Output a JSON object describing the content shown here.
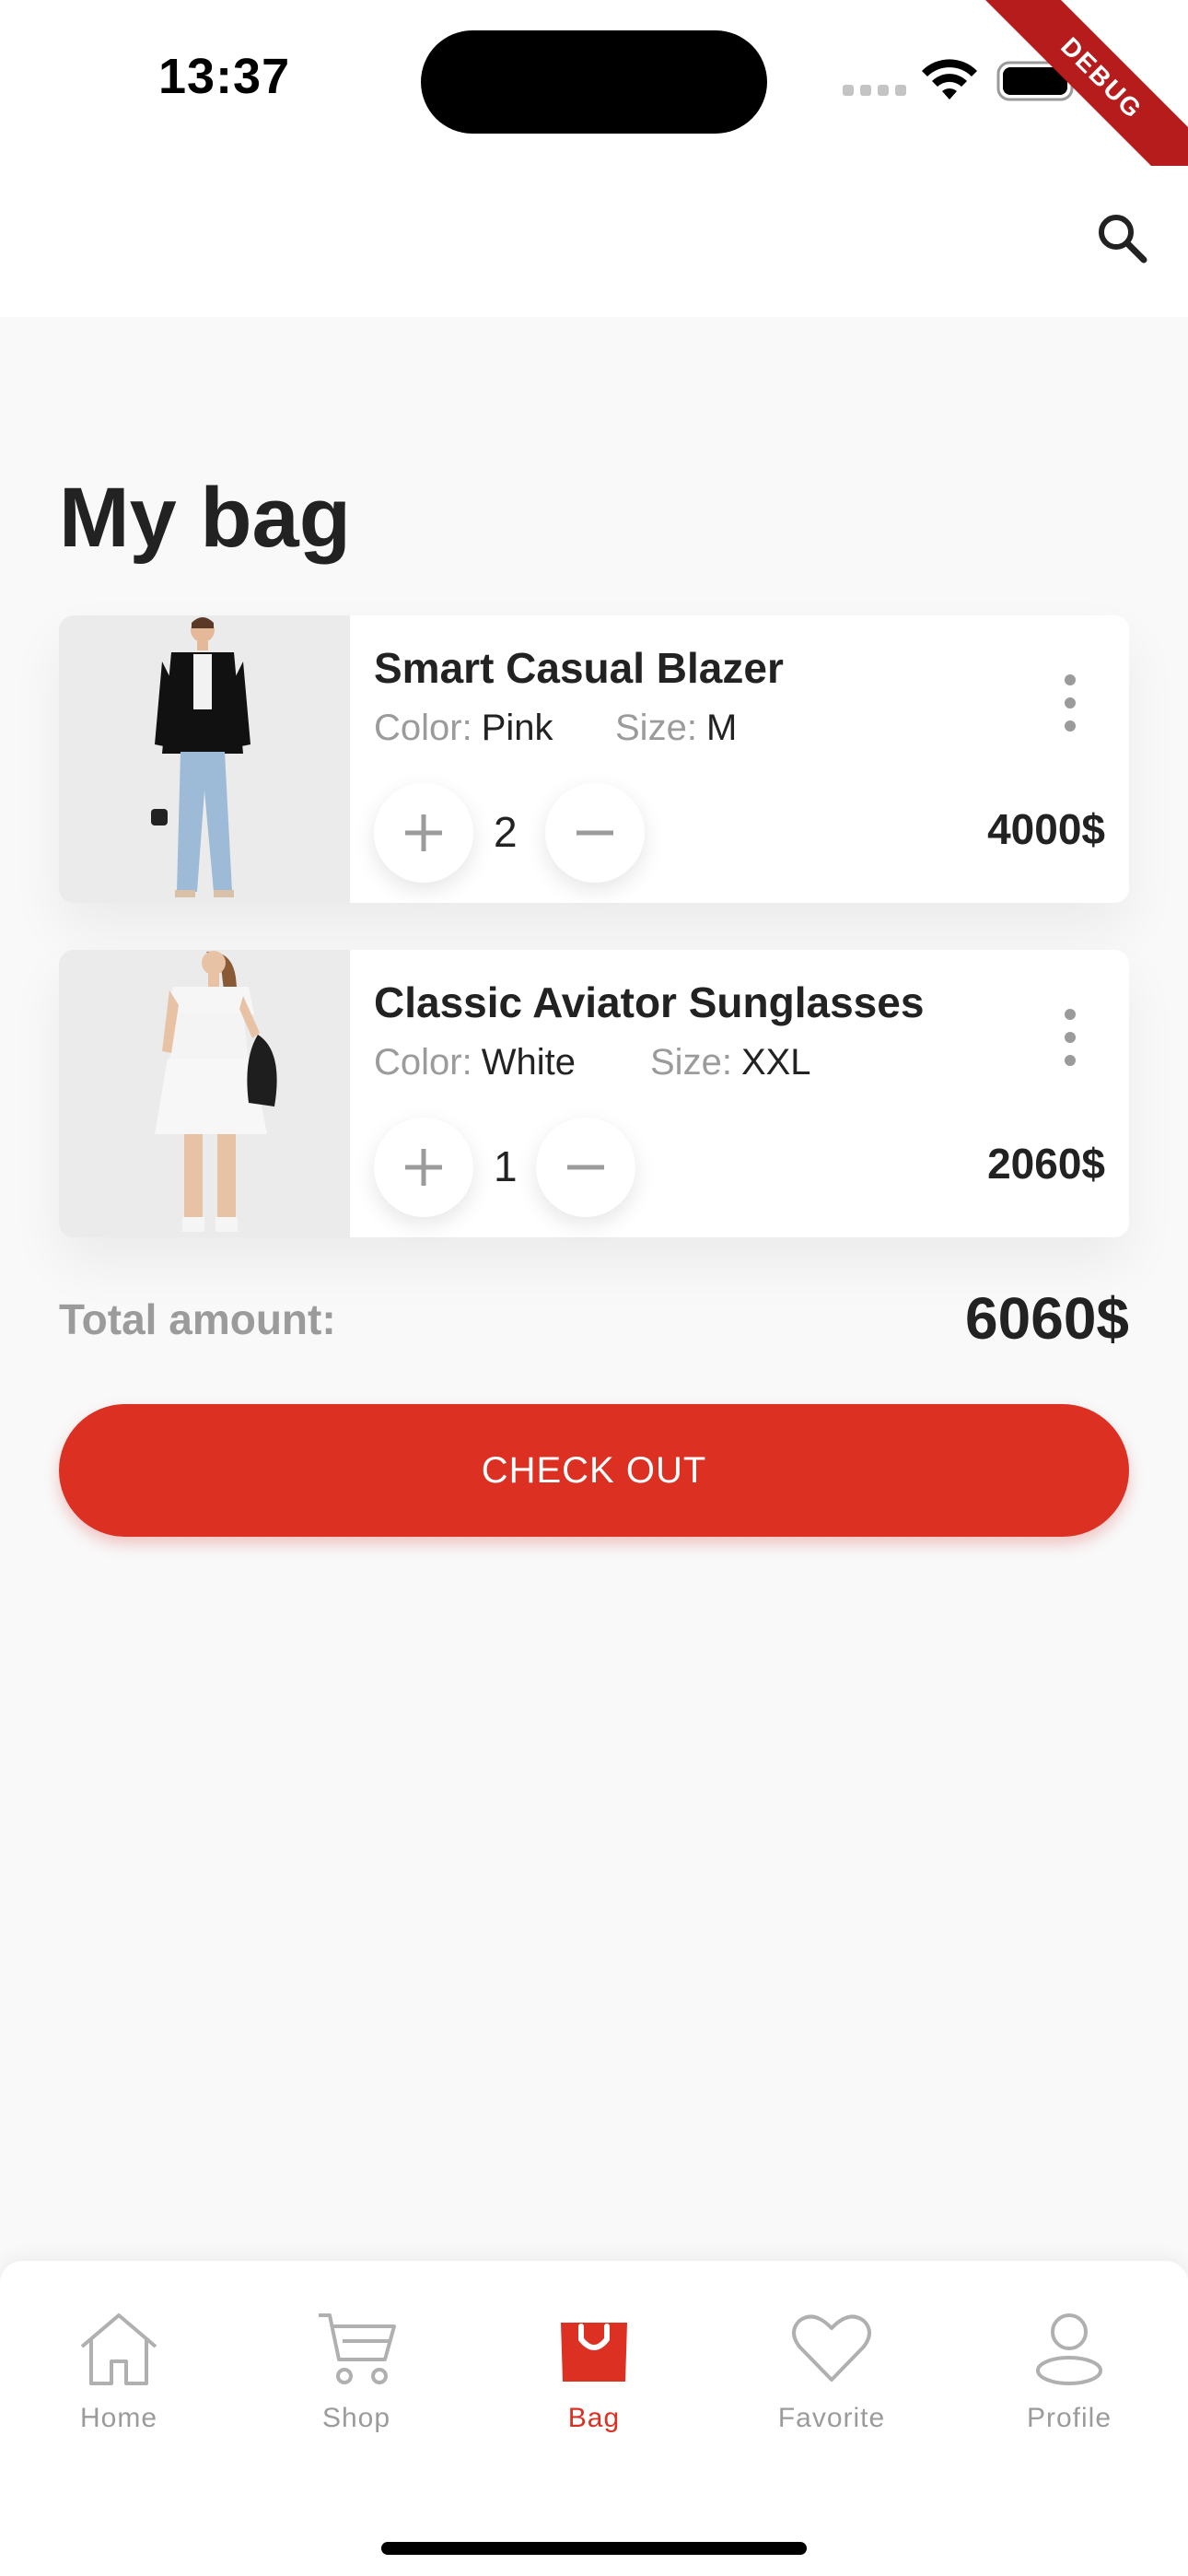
{
  "status_bar": {
    "time": "13:37",
    "debug_banner": "DEBUG"
  },
  "app_bar": {
    "search_icon": "search-icon"
  },
  "page": {
    "title": "My bag"
  },
  "cart": {
    "items": [
      {
        "name": "Smart Casual Blazer",
        "color_label": "Color:",
        "color": "Pink",
        "size_label": "Size:",
        "size": "M",
        "quantity": "2",
        "price": "4000$"
      },
      {
        "name": "Classic Aviator Sunglasses",
        "color_label": "Color:",
        "color": "White",
        "size_label": "Size:",
        "size": "XXL",
        "quantity": "1",
        "price": "2060$"
      }
    ],
    "total_label": "Total amount:",
    "total_value": "6060$",
    "checkout_label": "CHECK OUT"
  },
  "bottom_nav": {
    "items": [
      {
        "label": "Home",
        "icon": "home-icon"
      },
      {
        "label": "Shop",
        "icon": "cart-icon"
      },
      {
        "label": "Bag",
        "icon": "bag-icon",
        "active": true
      },
      {
        "label": "Favorite",
        "icon": "heart-icon"
      },
      {
        "label": "Profile",
        "icon": "profile-icon"
      }
    ]
  },
  "colors": {
    "accent": "#db3022",
    "background": "#f9f9f9",
    "text_primary": "#222222",
    "text_secondary": "#9b9b9b"
  }
}
